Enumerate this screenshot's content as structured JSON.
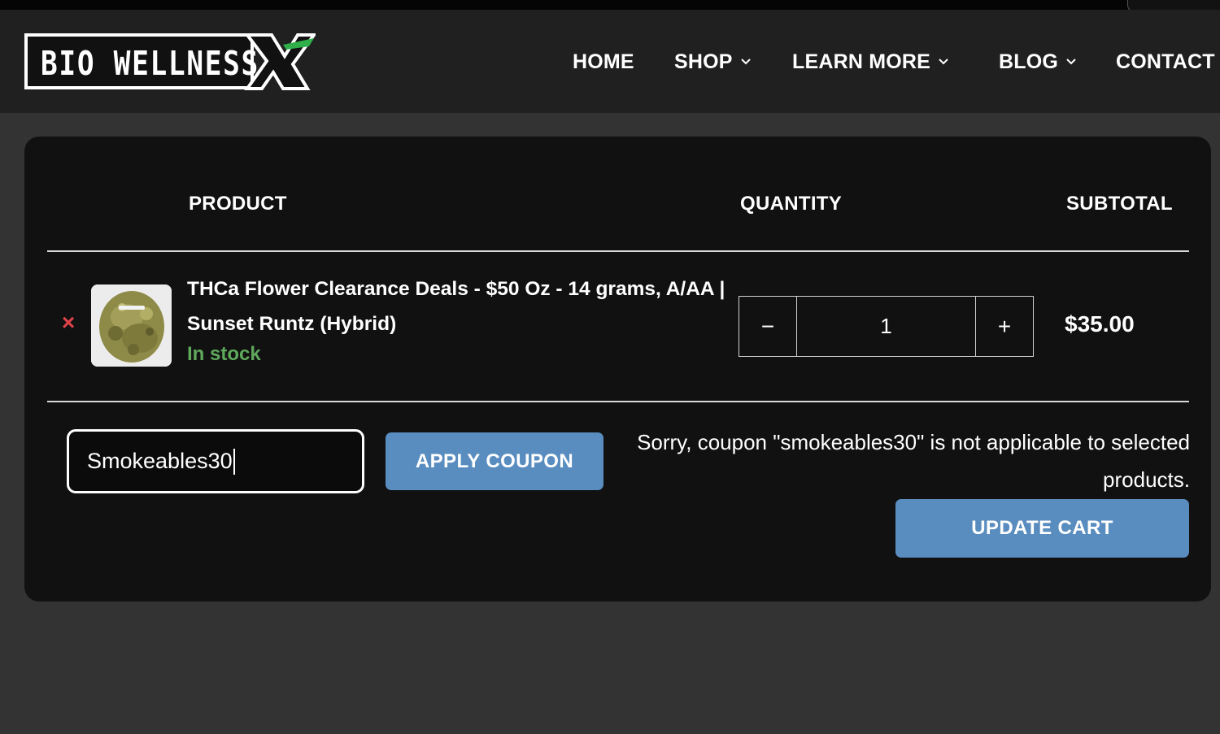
{
  "brand": {
    "logo_text": "BIO WELLNESS X"
  },
  "nav": {
    "items": [
      {
        "label": "HOME",
        "has_dropdown": false
      },
      {
        "label": "SHOP",
        "has_dropdown": true
      },
      {
        "label": "LEARN MORE",
        "has_dropdown": true
      },
      {
        "label": "BLOG",
        "has_dropdown": true
      },
      {
        "label": "CONTACT",
        "has_dropdown": false
      }
    ]
  },
  "cart": {
    "headers": {
      "product": "PRODUCT",
      "quantity": "QUANTITY",
      "subtotal": "SUBTOTAL"
    },
    "items": [
      {
        "name": "THCa Flower Clearance Deals - $50 Oz - 14 grams, A/AA | Sunset Runtz (Hybrid)",
        "stock_status": "In stock",
        "quantity": "1",
        "subtotal": "$35.00",
        "remove_glyph": "×",
        "minus_glyph": "−",
        "plus_glyph": "+"
      }
    ],
    "coupon": {
      "value": "Smokeables30",
      "apply_label": "APPLY COUPON",
      "notice": "Sorry, coupon \"smokeables30\" is not applicable to selected products."
    },
    "update_label": "UPDATE CART"
  },
  "colors": {
    "accent_blue": "#5a8dbf",
    "in_stock_green": "#5fa85c",
    "remove_red": "#e0424a",
    "logo_green": "#2fae4a"
  }
}
